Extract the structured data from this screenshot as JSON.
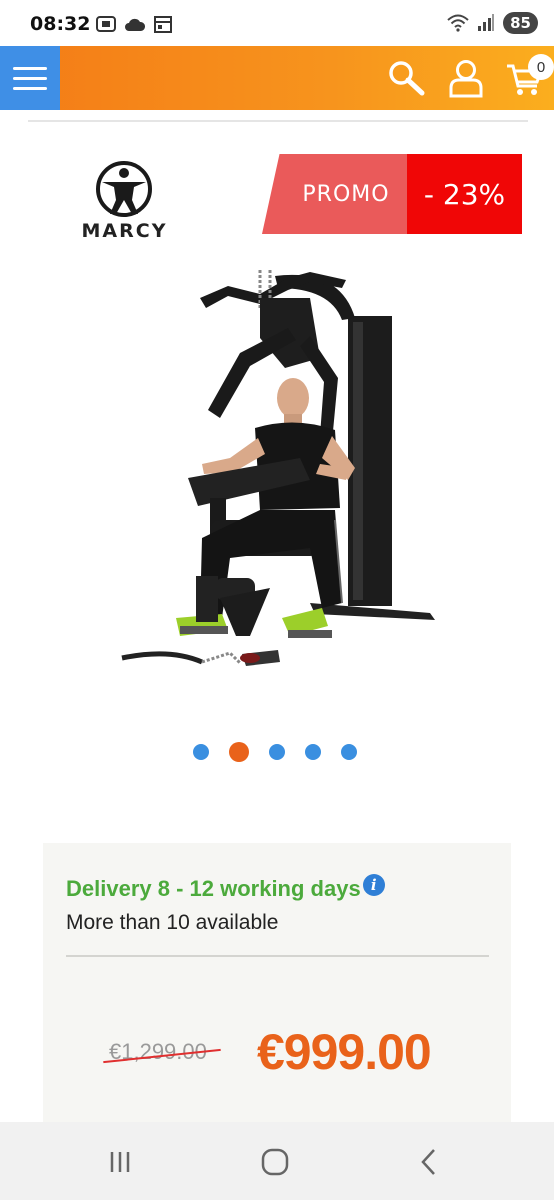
{
  "status_bar": {
    "time": "08:32",
    "battery": "85"
  },
  "header": {
    "cart_count": "0"
  },
  "brand": {
    "name": "MARCY"
  },
  "badges": {
    "promo": "PROMO",
    "discount": "- 23%"
  },
  "carousel": {
    "slides": 5,
    "active_index": 1
  },
  "product": {
    "image": "marcy-home-gym-with-man-seated"
  },
  "availability": {
    "delivery": "Delivery 8 - 12 working days",
    "stock": "More than 10 available"
  },
  "pricing": {
    "old_price": "€1,299.00",
    "new_price": "€999.00"
  },
  "colors": {
    "accent_orange": "#e9621a",
    "menu_blue": "#3f8fe6",
    "promo_red": "#f00606",
    "delivery_green": "#4caa3c"
  },
  "icons": [
    "menu-icon",
    "search-icon",
    "account-icon",
    "cart-icon",
    "info-icon",
    "recent-apps-icon",
    "home-icon",
    "back-icon"
  ]
}
